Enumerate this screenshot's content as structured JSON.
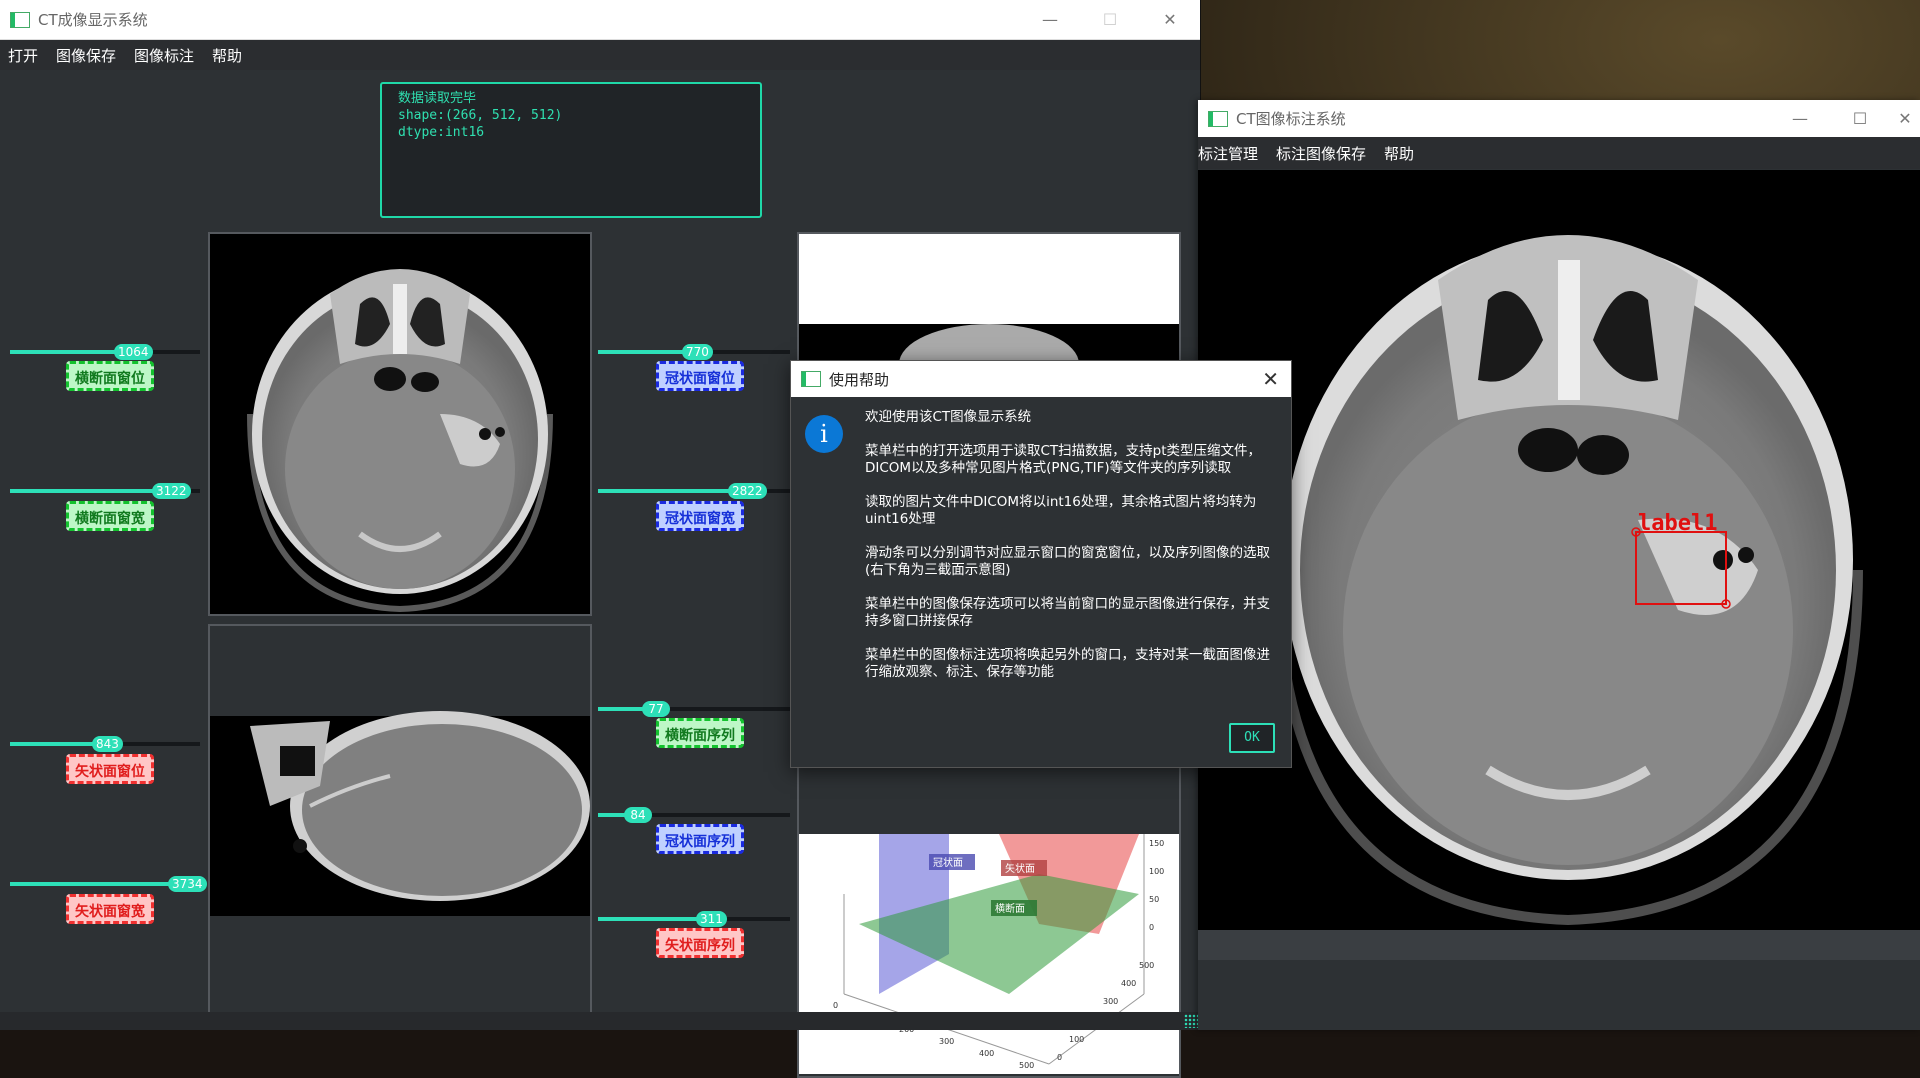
{
  "main_window": {
    "title": "CT成像显示系统",
    "menu": [
      "打开",
      "图像保存",
      "图像标注",
      "帮助"
    ],
    "controls": {
      "minimize": "—",
      "maximize": "☐",
      "close": "✕"
    }
  },
  "info_box": {
    "lines": [
      "数据读取完毕",
      "shape:(266, 512, 512)",
      "dtype:int16"
    ]
  },
  "sliders": {
    "axial_level": {
      "value": "1064",
      "label": "横断面窗位"
    },
    "axial_width": {
      "value": "3122",
      "label": "横断面窗宽"
    },
    "sagittal_level": {
      "value": "843",
      "label": "矢状面窗位"
    },
    "sagittal_width": {
      "value": "3734",
      "label": "矢状面窗宽"
    },
    "coronal_level": {
      "value": "770",
      "label": "冠状面窗位"
    },
    "coronal_width": {
      "value": "2822",
      "label": "冠状面窗宽"
    },
    "axial_index": {
      "value": "77",
      "label": "横断面序列"
    },
    "coronal_index": {
      "value": "84",
      "label": "冠状面序列"
    },
    "sagittal_index": {
      "value": "311",
      "label": "矢状面序列"
    }
  },
  "plot3d": {
    "labels": {
      "coronal": "冠状面",
      "sagittal": "矢状面",
      "axial": "横断面"
    },
    "x_ticks": [
      "0",
      "100",
      "200",
      "300",
      "400",
      "500"
    ],
    "y_ticks": [
      "0",
      "100",
      "200",
      "300",
      "400",
      "500"
    ],
    "z_ticks": [
      "150",
      "100",
      "50",
      "0"
    ],
    "colors": {
      "coronal": "#5b5bd6",
      "sagittal": "#e84545",
      "axial": "#2f9a3a"
    }
  },
  "help_dialog": {
    "title": "使用帮助",
    "icon": "i",
    "paragraphs": [
      "欢迎使用该CT图像显示系统",
      "菜单栏中的打开选项用于读取CT扫描数据，支持pt类型压缩文件，DICOM以及多种常见图片格式(PNG,TIF)等文件夹的序列读取",
      "读取的图片文件中DICOM将以int16处理，其余格式图片将均转为uint16处理",
      "滑动条可以分别调节对应显示窗口的窗宽窗位，以及序列图像的选取(右下角为三截面示意图)",
      "菜单栏中的图像保存选项可以将当前窗口的显示图像进行保存，并支持多窗口拼接保存",
      "菜单栏中的图像标注选项将唤起另外的窗口，支持对某一截面图像进行缩放观察、标注、保存等功能"
    ],
    "ok_label": "OK"
  },
  "annotation_window": {
    "title": "CT图像标注系统",
    "menu": [
      "标注管理",
      "标注图像保存",
      "帮助"
    ],
    "box_label": "label1",
    "controls": {
      "minimize": "—",
      "maximize": "☐",
      "close": "✕"
    }
  }
}
